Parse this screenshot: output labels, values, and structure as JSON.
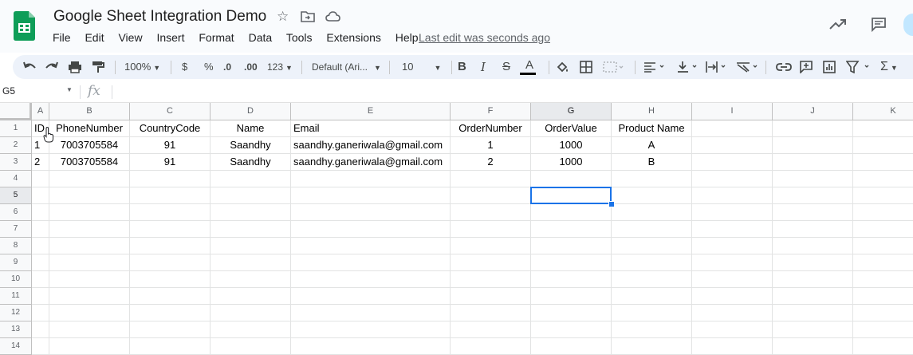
{
  "app": {
    "doc_title": "Google Sheet Integration Demo",
    "last_edit": "Last edit was seconds ago",
    "menu": [
      "File",
      "Edit",
      "View",
      "Insert",
      "Format",
      "Data",
      "Tools",
      "Extensions",
      "Help"
    ],
    "icons": [
      "sheets-logo-icon",
      "star-icon",
      "folder-move-icon",
      "cloud-status-icon",
      "trending-up-icon",
      "comments-icon"
    ]
  },
  "toolbar": {
    "zoom": "100%",
    "currency": "$",
    "percent": "%",
    "decrease_decimal": ".0",
    "increase_decimal": ".00",
    "more_formats": "123",
    "font": "Default (Ari...",
    "font_size": "10",
    "bold": "B",
    "italic": "I",
    "strike": "S",
    "text_color": "A",
    "sum": "Σ"
  },
  "formula_bar": {
    "name_box": "G5",
    "fx": "fx"
  },
  "columns": [
    "A",
    "B",
    "C",
    "D",
    "E",
    "F",
    "G",
    "H",
    "I",
    "J",
    "K"
  ],
  "rows": [
    "1",
    "2",
    "3",
    "4",
    "5",
    "6",
    "7",
    "8",
    "9",
    "10",
    "11",
    "12",
    "13",
    "14"
  ],
  "cells": {
    "r1": [
      "ID",
      "PhoneNumber",
      "CountryCode",
      "Name",
      "Email",
      "OrderNumber",
      "OrderValue",
      "Product Name"
    ],
    "r2": [
      "1",
      "7003705584",
      "91",
      "Saandhy",
      "saandhy.ganeriwala@gmail.com",
      "1",
      "1000",
      "A"
    ],
    "r3": [
      "2",
      "7003705584",
      "91",
      "Saandhy",
      "saandhy.ganeriwala@gmail.com",
      "2",
      "1000",
      "B"
    ]
  },
  "selection": {
    "cell": "G5",
    "color": "#1a73e8"
  },
  "colors": {
    "header_bg": "#f9fbfd",
    "toolbar_bg": "#edf2fa",
    "sheets_green": "#0f9d58"
  }
}
